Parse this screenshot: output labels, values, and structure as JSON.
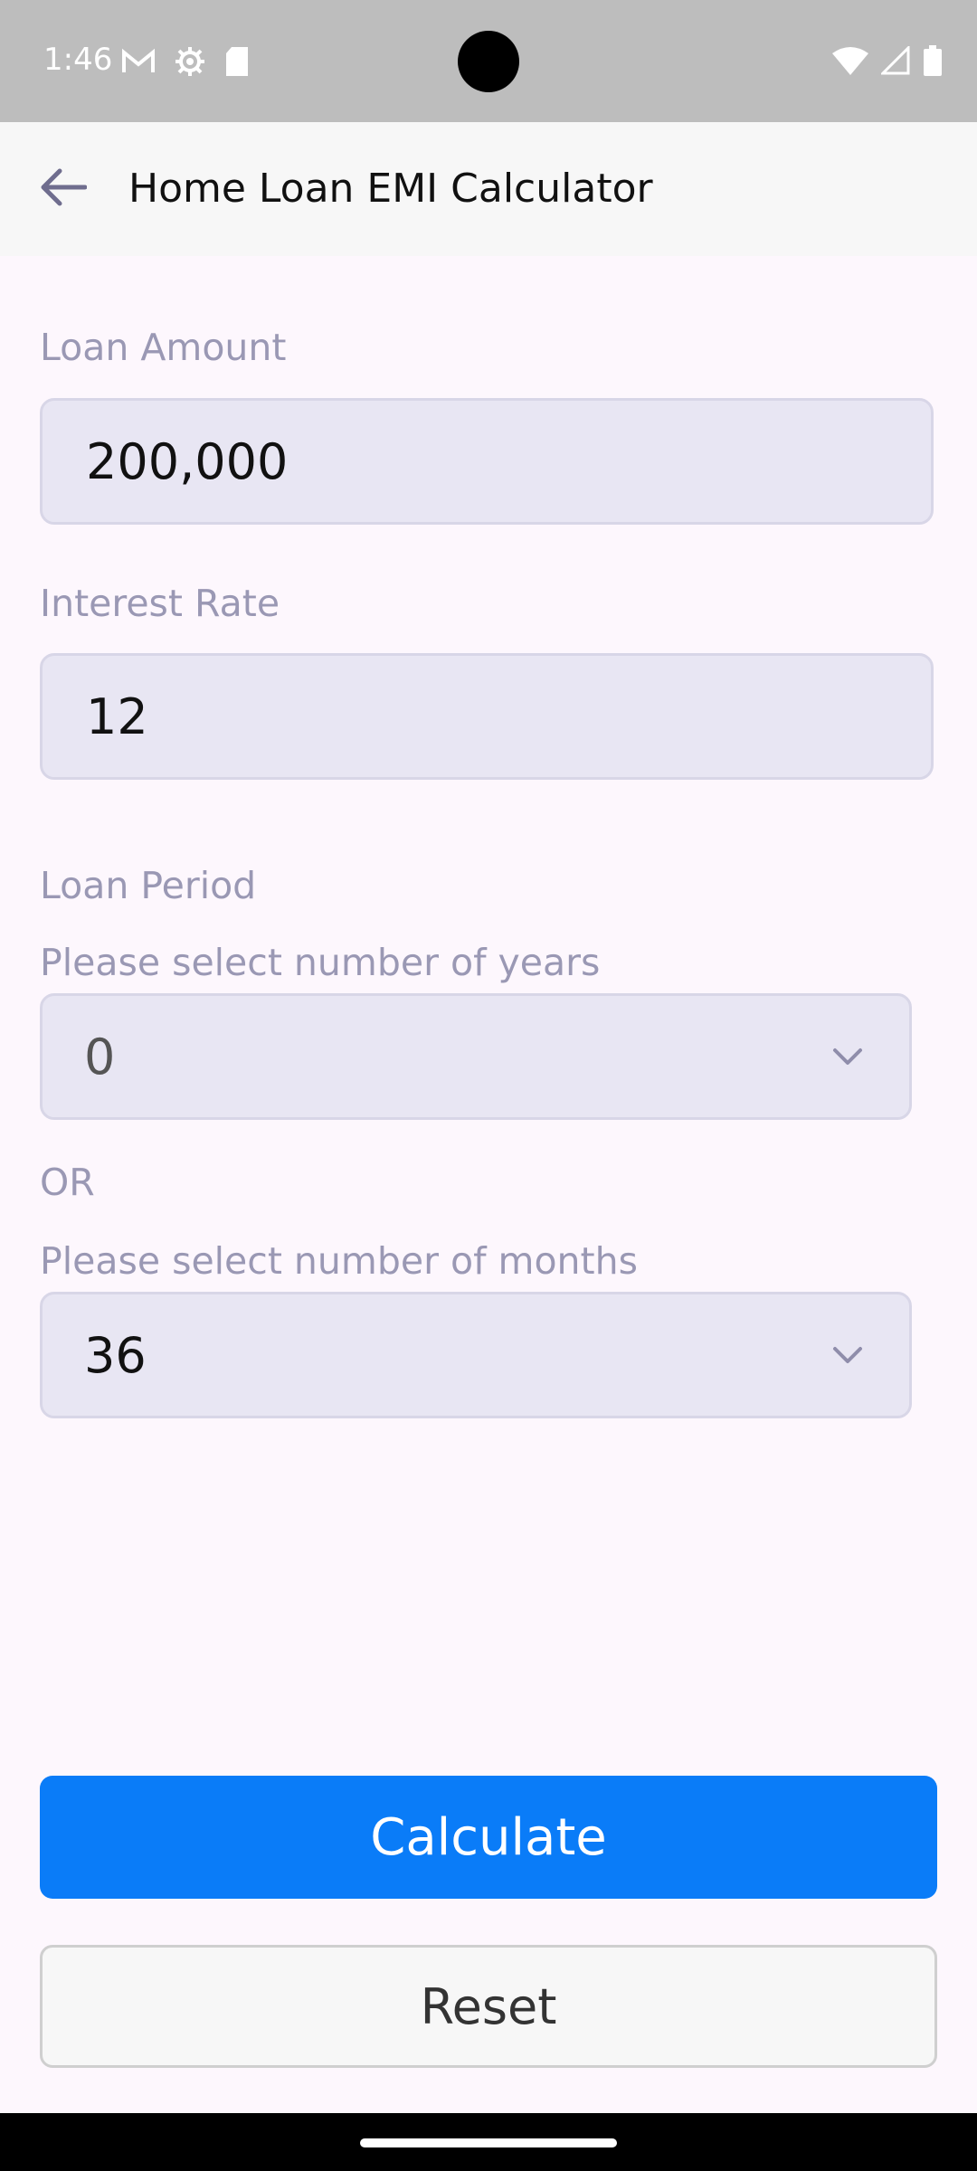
{
  "status_bar": {
    "time": "1:46",
    "left_icons": [
      "gmail-icon",
      "settings-icon",
      "sd-card-icon"
    ],
    "right_icons": [
      "wifi-icon",
      "signal-icon",
      "battery-icon"
    ]
  },
  "app_bar": {
    "title": "Home Loan EMI Calculator",
    "back_icon": "arrow-back-icon"
  },
  "form": {
    "loan_amount_label": "Loan Amount",
    "loan_amount_value": "200,000",
    "interest_rate_label": "Interest Rate",
    "interest_rate_value": "12",
    "loan_period_label": "Loan Period",
    "years_label": "Please select number of years",
    "years_value": "0",
    "or_label": "OR",
    "months_label": "Please select number of months",
    "months_value": "36"
  },
  "buttons": {
    "calculate": "Calculate",
    "reset": "Reset"
  },
  "colors": {
    "primary": "#0a7cf8",
    "field_bg": "#e8e6f3",
    "label": "#9a98b4",
    "page_bg": "#fdf7fd"
  }
}
